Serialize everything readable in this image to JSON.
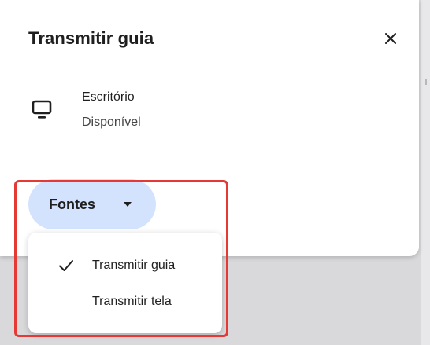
{
  "dialog": {
    "title": "Transmitir guia",
    "close_icon": "close-icon"
  },
  "device": {
    "icon": "monitor-icon",
    "name": "Escritório",
    "status": "Disponível"
  },
  "sources": {
    "label": "Fontes",
    "caret_icon": "caret-down-icon",
    "menu": [
      {
        "label": "Transmitir guia",
        "selected": true,
        "icon": "check-icon"
      },
      {
        "label": "Transmitir tela",
        "selected": false
      }
    ]
  },
  "annotation": {
    "highlight_color": "#e53935"
  },
  "colors": {
    "accent_pill": "#d3e3fd",
    "text_primary": "#1f1f1f",
    "text_secondary": "#444746"
  }
}
